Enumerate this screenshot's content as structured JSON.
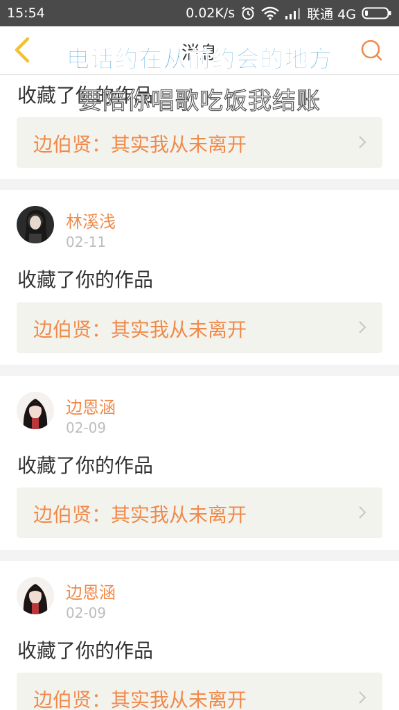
{
  "status_bar": {
    "time": "15:54",
    "network_speed": "0.02K/s",
    "carrier": "联通 4G",
    "icons": [
      "alarm-icon",
      "wifi-icon",
      "signal-icon",
      "battery-icon"
    ]
  },
  "nav": {
    "title": "消息",
    "back_icon": "back-chevron-icon",
    "search_icon": "search-icon",
    "accent_color": "#f08a4b"
  },
  "lyrics": {
    "line1": "电话约在从前约会的地方",
    "line2": "要陪你唱歌吃饭我结账"
  },
  "feed": {
    "partial_entry": {
      "action": "收藏了你的作品",
      "quote": "边伯贤：其实我从未离开"
    },
    "entries": [
      {
        "username": "林溪浅",
        "date": "02-11",
        "action": "收藏了你的作品",
        "quote": "边伯贤：其实我从未离开"
      },
      {
        "username": "边恩涵",
        "date": "02-09",
        "action": "收藏了你的作品",
        "quote": "边伯贤：其实我从未离开"
      },
      {
        "username": "边恩涵",
        "date": "02-09",
        "action": "收藏了你的作品",
        "quote": "边伯贤：其实我从未离开"
      }
    ]
  }
}
